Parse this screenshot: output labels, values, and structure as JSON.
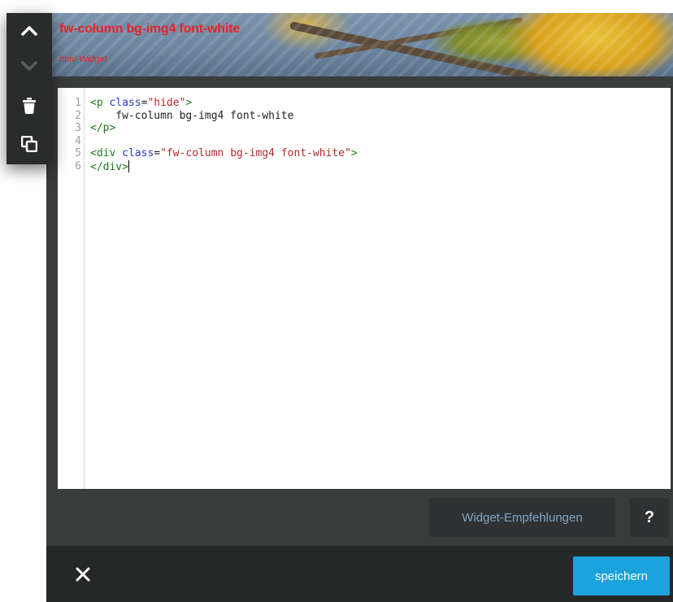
{
  "toolbar": {
    "icons": [
      "chevron-up-icon",
      "chevron-down-icon",
      "trash-icon",
      "copy-icon"
    ]
  },
  "widget": {
    "title": "fw-column bg-img4 font-white",
    "type_label": "html-Widget"
  },
  "editor": {
    "line_numbers": [
      "1",
      "2",
      "3",
      "4",
      "5",
      "6"
    ]
  },
  "code": {
    "l1_open": "<p ",
    "l1_attr": "class",
    "l1_eq": "=",
    "l1_str": "\"hide\"",
    "l1_close": ">",
    "l2_text": "    fw-column bg-img4 font-white",
    "l3_tag": "</p>",
    "l5_open": "<div ",
    "l5_attr": "class",
    "l5_eq": "=",
    "l5_str": "\"fw-column bg-img4 font-white\"",
    "l5_close": ">",
    "l6_tag": "</div>"
  },
  "buttons": {
    "recommendations": "Widget-Empfehlungen",
    "help": "?",
    "save": "speichern",
    "close_icon": "close-icon"
  },
  "colors": {
    "title_red": "#e8212b",
    "save_blue": "#1aa3dc",
    "panel_dark": "#3a3b3b",
    "footer_dark": "#262727"
  }
}
